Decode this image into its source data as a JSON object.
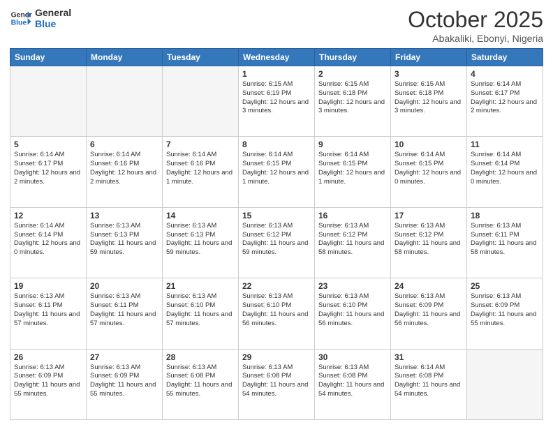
{
  "header": {
    "logo_general": "General",
    "logo_blue": "Blue",
    "month": "October 2025",
    "location": "Abakaliki, Ebonyi, Nigeria"
  },
  "weekdays": [
    "Sunday",
    "Monday",
    "Tuesday",
    "Wednesday",
    "Thursday",
    "Friday",
    "Saturday"
  ],
  "weeks": [
    [
      {
        "day": "",
        "info": "",
        "empty": true
      },
      {
        "day": "",
        "info": "",
        "empty": true
      },
      {
        "day": "",
        "info": "",
        "empty": true
      },
      {
        "day": "1",
        "info": "Sunrise: 6:15 AM\nSunset: 6:19 PM\nDaylight: 12 hours and 3 minutes."
      },
      {
        "day": "2",
        "info": "Sunrise: 6:15 AM\nSunset: 6:18 PM\nDaylight: 12 hours and 3 minutes."
      },
      {
        "day": "3",
        "info": "Sunrise: 6:15 AM\nSunset: 6:18 PM\nDaylight: 12 hours and 3 minutes."
      },
      {
        "day": "4",
        "info": "Sunrise: 6:14 AM\nSunset: 6:17 PM\nDaylight: 12 hours and 2 minutes."
      }
    ],
    [
      {
        "day": "5",
        "info": "Sunrise: 6:14 AM\nSunset: 6:17 PM\nDaylight: 12 hours and 2 minutes."
      },
      {
        "day": "6",
        "info": "Sunrise: 6:14 AM\nSunset: 6:16 PM\nDaylight: 12 hours and 2 minutes."
      },
      {
        "day": "7",
        "info": "Sunrise: 6:14 AM\nSunset: 6:16 PM\nDaylight: 12 hours and 1 minute."
      },
      {
        "day": "8",
        "info": "Sunrise: 6:14 AM\nSunset: 6:15 PM\nDaylight: 12 hours and 1 minute."
      },
      {
        "day": "9",
        "info": "Sunrise: 6:14 AM\nSunset: 6:15 PM\nDaylight: 12 hours and 1 minute."
      },
      {
        "day": "10",
        "info": "Sunrise: 6:14 AM\nSunset: 6:15 PM\nDaylight: 12 hours and 0 minutes."
      },
      {
        "day": "11",
        "info": "Sunrise: 6:14 AM\nSunset: 6:14 PM\nDaylight: 12 hours and 0 minutes."
      }
    ],
    [
      {
        "day": "12",
        "info": "Sunrise: 6:14 AM\nSunset: 6:14 PM\nDaylight: 12 hours and 0 minutes."
      },
      {
        "day": "13",
        "info": "Sunrise: 6:13 AM\nSunset: 6:13 PM\nDaylight: 11 hours and 59 minutes."
      },
      {
        "day": "14",
        "info": "Sunrise: 6:13 AM\nSunset: 6:13 PM\nDaylight: 11 hours and 59 minutes."
      },
      {
        "day": "15",
        "info": "Sunrise: 6:13 AM\nSunset: 6:12 PM\nDaylight: 11 hours and 59 minutes."
      },
      {
        "day": "16",
        "info": "Sunrise: 6:13 AM\nSunset: 6:12 PM\nDaylight: 11 hours and 58 minutes."
      },
      {
        "day": "17",
        "info": "Sunrise: 6:13 AM\nSunset: 6:12 PM\nDaylight: 11 hours and 58 minutes."
      },
      {
        "day": "18",
        "info": "Sunrise: 6:13 AM\nSunset: 6:11 PM\nDaylight: 11 hours and 58 minutes."
      }
    ],
    [
      {
        "day": "19",
        "info": "Sunrise: 6:13 AM\nSunset: 6:11 PM\nDaylight: 11 hours and 57 minutes."
      },
      {
        "day": "20",
        "info": "Sunrise: 6:13 AM\nSunset: 6:11 PM\nDaylight: 11 hours and 57 minutes."
      },
      {
        "day": "21",
        "info": "Sunrise: 6:13 AM\nSunset: 6:10 PM\nDaylight: 11 hours and 57 minutes."
      },
      {
        "day": "22",
        "info": "Sunrise: 6:13 AM\nSunset: 6:10 PM\nDaylight: 11 hours and 56 minutes."
      },
      {
        "day": "23",
        "info": "Sunrise: 6:13 AM\nSunset: 6:10 PM\nDaylight: 11 hours and 56 minutes."
      },
      {
        "day": "24",
        "info": "Sunrise: 6:13 AM\nSunset: 6:09 PM\nDaylight: 11 hours and 56 minutes."
      },
      {
        "day": "25",
        "info": "Sunrise: 6:13 AM\nSunset: 6:09 PM\nDaylight: 11 hours and 55 minutes."
      }
    ],
    [
      {
        "day": "26",
        "info": "Sunrise: 6:13 AM\nSunset: 6:09 PM\nDaylight: 11 hours and 55 minutes."
      },
      {
        "day": "27",
        "info": "Sunrise: 6:13 AM\nSunset: 6:09 PM\nDaylight: 11 hours and 55 minutes."
      },
      {
        "day": "28",
        "info": "Sunrise: 6:13 AM\nSunset: 6:08 PM\nDaylight: 11 hours and 55 minutes."
      },
      {
        "day": "29",
        "info": "Sunrise: 6:13 AM\nSunset: 6:08 PM\nDaylight: 11 hours and 54 minutes."
      },
      {
        "day": "30",
        "info": "Sunrise: 6:13 AM\nSunset: 6:08 PM\nDaylight: 11 hours and 54 minutes."
      },
      {
        "day": "31",
        "info": "Sunrise: 6:14 AM\nSunset: 6:08 PM\nDaylight: 11 hours and 54 minutes."
      },
      {
        "day": "",
        "info": "",
        "empty": true
      }
    ]
  ]
}
